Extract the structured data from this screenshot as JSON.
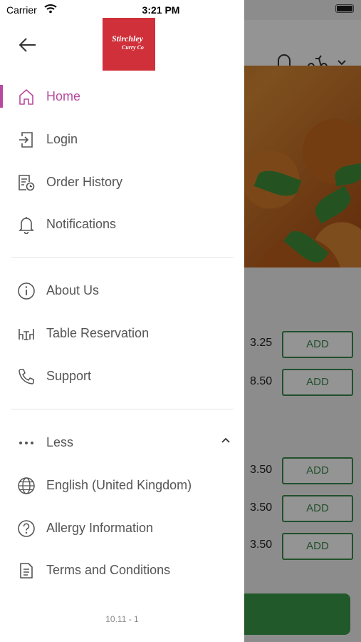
{
  "status_bar": {
    "carrier": "Carrier",
    "time": "3:21 PM"
  },
  "brand": {
    "line1": "Stirchley",
    "line2": "Curry Co",
    "color": "#d0303a"
  },
  "accent_color": "#b74a9e",
  "drawer": {
    "primary_items": [
      {
        "label": "Home",
        "icon": "home-icon",
        "active": true
      },
      {
        "label": "Login",
        "icon": "login-icon"
      },
      {
        "label": "Order History",
        "icon": "order-history-icon"
      },
      {
        "label": "Notifications",
        "icon": "bell-icon"
      }
    ],
    "secondary_items": [
      {
        "label": "About Us",
        "icon": "info-icon"
      },
      {
        "label": "Table Reservation",
        "icon": "table-icon"
      },
      {
        "label": "Support",
        "icon": "phone-icon"
      }
    ],
    "less_label": "Less",
    "more_items": [
      {
        "label": "English (United Kingdom)",
        "icon": "globe-icon"
      },
      {
        "label": "Allergy Information",
        "icon": "question-icon"
      },
      {
        "label": "Terms and Conditions",
        "icon": "document-icon"
      }
    ],
    "version": "10.11 - 1"
  },
  "background": {
    "add_label": "ADD",
    "prices": [
      "3.25",
      "8.50",
      "3.50",
      "3.50",
      "3.50"
    ],
    "add_button_color": "#3a8a4c"
  }
}
